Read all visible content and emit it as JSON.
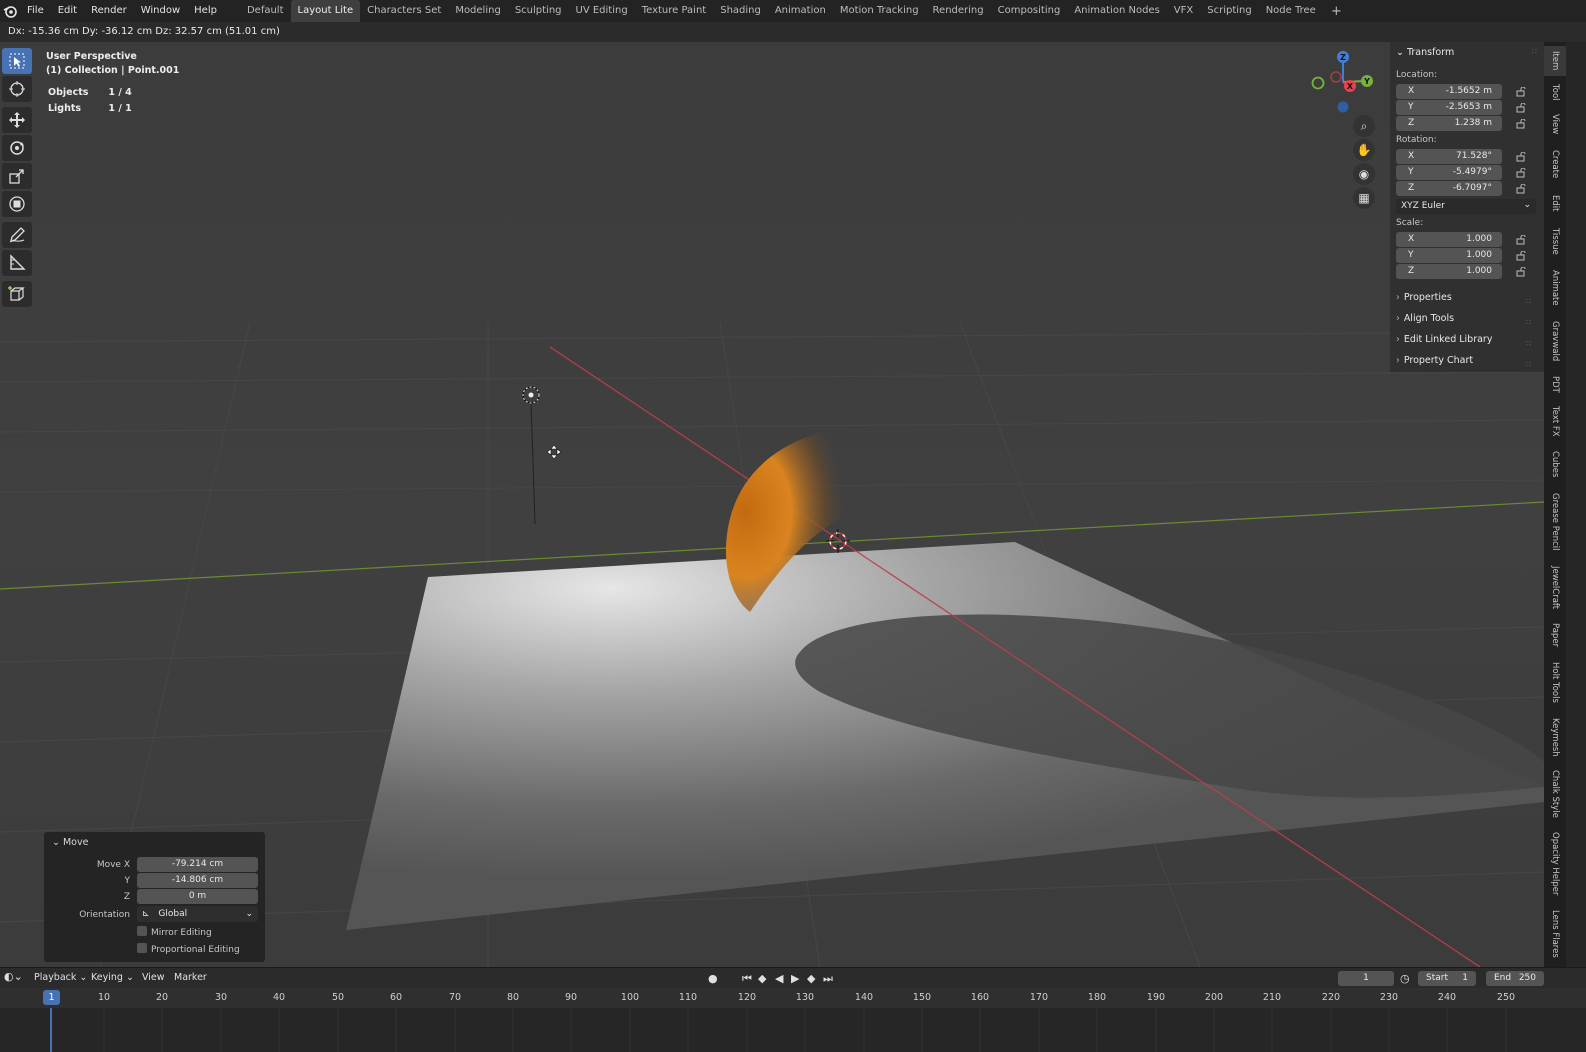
{
  "topbar": {
    "logo_icon": "blender-icon",
    "menus": [
      "File",
      "Edit",
      "Render",
      "Window",
      "Help"
    ],
    "workspaces": [
      "Default",
      "Layout Lite",
      "Characters Set",
      "Modeling",
      "Sculpting",
      "UV Editing",
      "Texture Paint",
      "Shading",
      "Animation",
      "Motion Tracking",
      "Rendering",
      "Compositing",
      "Animation Nodes",
      "VFX",
      "Scripting",
      "Node Tree"
    ],
    "active_workspace": "Layout Lite",
    "add_label": "+"
  },
  "header": {
    "status": "Dx: -15.36 cm   Dy: -36.12 cm   Dz: 32.57 cm (51.01 cm)"
  },
  "viewport": {
    "perspective": "User Perspective",
    "collection": "(1) Collection | Point.001",
    "stats": [
      {
        "label": "Objects",
        "value": "1 / 4"
      },
      {
        "label": "Lights",
        "value": "1 / 1"
      }
    ]
  },
  "gizmo": {
    "x": "X",
    "y": "Y",
    "z": "Z",
    "x_color": "#e8404f",
    "y_color": "#76b33a",
    "z_color": "#3f7fd8"
  },
  "npanel": {
    "transform_title": "Transform",
    "location_label": "Location:",
    "location": [
      {
        "axis": "X",
        "value": "-1.5652 m"
      },
      {
        "axis": "Y",
        "value": "-2.5653 m"
      },
      {
        "axis": "Z",
        "value": "1.238 m"
      }
    ],
    "rotation_label": "Rotation:",
    "rotation": [
      {
        "axis": "X",
        "value": "71.528°"
      },
      {
        "axis": "Y",
        "value": "-5.4979°"
      },
      {
        "axis": "Z",
        "value": "-6.7097°"
      }
    ],
    "rotation_mode": "XYZ Euler",
    "scale_label": "Scale:",
    "scale": [
      {
        "axis": "X",
        "value": "1.000"
      },
      {
        "axis": "Y",
        "value": "1.000"
      },
      {
        "axis": "Z",
        "value": "1.000"
      }
    ],
    "subpanels": [
      "Properties",
      "Align Tools",
      "Edit Linked Library",
      "Property Chart"
    ]
  },
  "side_tabs": [
    "Item",
    "Tool",
    "View",
    "Create",
    "Edit",
    "Tissue",
    "Animate",
    "Gravwald",
    "PDT",
    "Text FX",
    "Cubes",
    "Grease Pencil",
    "JewelCraft",
    "Paper",
    "Holt Tools",
    "Keymesh",
    "Chalk Style",
    "Opacity Helper",
    "Lens Flares"
  ],
  "redo_panel": {
    "title": "Move",
    "move_x_label": "Move X",
    "move_x": "-79.214 cm",
    "y_label": "Y",
    "y": "-14.806 cm",
    "z_label": "Z",
    "z": "0 m",
    "orientation_label": "Orientation",
    "orientation": "Global",
    "mirror_label": "Mirror Editing",
    "proportional_label": "Proportional Editing"
  },
  "timeline": {
    "menus": [
      "Playback",
      "Keying",
      "View",
      "Marker"
    ],
    "current_frame": "1",
    "start_label": "Start",
    "start": "1",
    "end_label": "End",
    "end": "250",
    "ticks": [
      "10",
      "20",
      "30",
      "40",
      "50",
      "60",
      "70",
      "80",
      "90",
      "100",
      "110",
      "120",
      "130",
      "140",
      "150",
      "160",
      "170",
      "180",
      "190",
      "200",
      "210",
      "220",
      "230",
      "240",
      "250"
    ],
    "cursor_label": "1"
  },
  "colors": {
    "accent": "#4772b3",
    "sphere": "#d27a1a",
    "x_axis_line": "#b8404a",
    "y_axis_line": "#6b8a33"
  }
}
